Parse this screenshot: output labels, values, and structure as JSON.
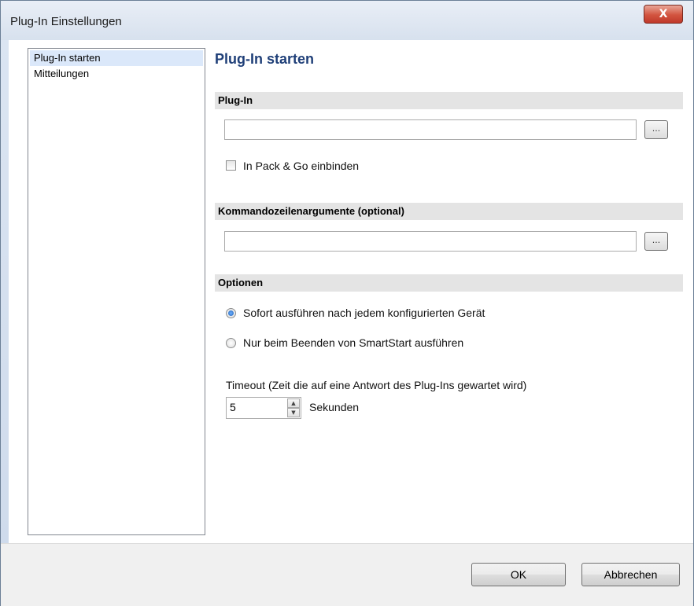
{
  "window": {
    "title": "Plug-In Einstellungen",
    "close_label": "X"
  },
  "nav": {
    "items": [
      {
        "label": "Plug-In starten",
        "selected": true
      },
      {
        "label": "Mitteilungen",
        "selected": false
      }
    ]
  },
  "page": {
    "title": "Plug-In starten"
  },
  "plugin": {
    "header": "Plug-In",
    "path_value": "",
    "browse_label": "...",
    "pack_go_label": "In Pack & Go einbinden",
    "pack_go_checked": false
  },
  "args": {
    "header": "Kommandozeilenargumente (optional)",
    "value": "",
    "browse_label": "..."
  },
  "options": {
    "header": "Optionen",
    "radio_immediate": "Sofort ausführen nach jedem konfigurierten Gerät",
    "radio_on_exit": "Nur beim Beenden von SmartStart ausführen",
    "selected": "immediate",
    "timeout_label": "Timeout (Zeit die auf eine Antwort des Plug-Ins gewartet wird)",
    "timeout_value": "5",
    "timeout_unit": "Sekunden"
  },
  "footer": {
    "ok_label": "OK",
    "cancel_label": "Abbrechen"
  },
  "colors": {
    "title_blue": "#1f3f78",
    "selection": "#dbe8fa",
    "close_red": "#c0392b"
  }
}
